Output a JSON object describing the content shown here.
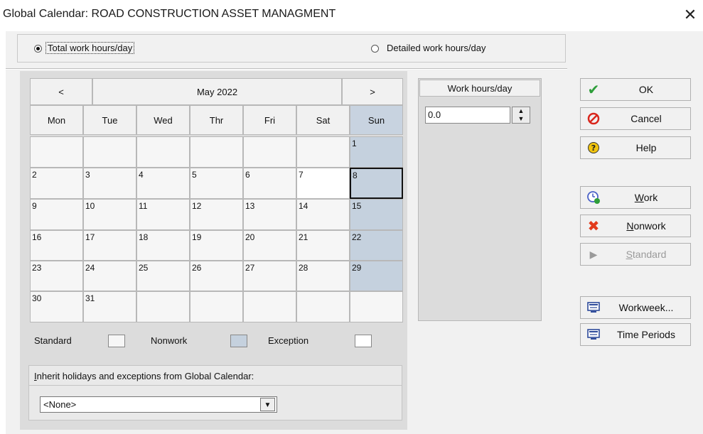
{
  "window": {
    "title": "Global Calendar: ROAD CONSTRUCTION ASSET MANAGMENT",
    "close_glyph": "✕"
  },
  "mode": {
    "total": {
      "label": "Total work hours/day",
      "checked": true
    },
    "detailed": {
      "label": "Detailed work hours/day",
      "checked": false
    }
  },
  "calendar": {
    "prev": "<",
    "next": ">",
    "month_label": "May 2022",
    "weekdays": [
      "Mon",
      "Tue",
      "Wed",
      "Thr",
      "Fri",
      "Sat",
      "Sun"
    ],
    "weeks": [
      [
        "",
        "",
        "",
        "",
        "",
        "",
        "1"
      ],
      [
        "2",
        "3",
        "4",
        "5",
        "6",
        "7",
        "8"
      ],
      [
        "9",
        "10",
        "11",
        "12",
        "13",
        "14",
        "15"
      ],
      [
        "16",
        "17",
        "18",
        "19",
        "20",
        "21",
        "22"
      ],
      [
        "23",
        "24",
        "25",
        "26",
        "27",
        "28",
        "29"
      ],
      [
        "30",
        "31",
        "",
        "",
        "",
        "",
        ""
      ]
    ],
    "selected_date": "8",
    "white_date": "7"
  },
  "legend": {
    "standard": "Standard",
    "nonwork": "Nonwork",
    "exception": "Exception"
  },
  "inherit": {
    "label": "Inherit holidays and exceptions from Global Calendar:",
    "value": "<None>"
  },
  "work_hours": {
    "header": "Work hours/day",
    "value": "0.0"
  },
  "buttons": {
    "ok": "OK",
    "cancel": "Cancel",
    "help": "Help",
    "work": "Work",
    "nonwork": "Nonwork",
    "standard": "Standard",
    "workweek": "Workweek...",
    "time_periods": "Time Periods"
  },
  "colors": {
    "nonwork_fill": "#c5d1de",
    "ok_check": "#2e9e3a",
    "cancel_red": "#d9261c",
    "help_yellow": "#f1c40f",
    "nonwork_x": "#e23b1c"
  }
}
